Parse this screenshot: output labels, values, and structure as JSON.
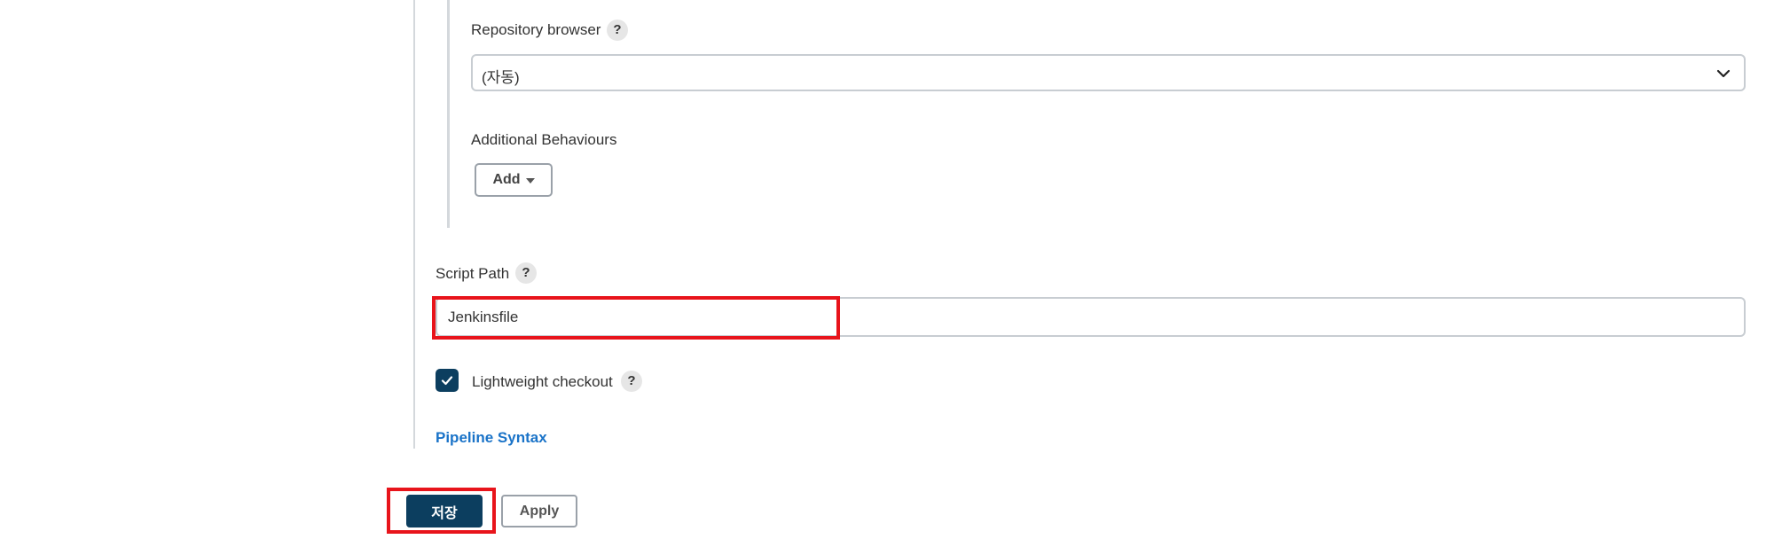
{
  "repository_browser": {
    "label": "Repository browser",
    "help_icon": "?",
    "selected_value": "(자동)"
  },
  "additional_behaviours": {
    "label": "Additional Behaviours",
    "add_label": "Add"
  },
  "script_path": {
    "label": "Script Path",
    "help_icon": "?",
    "value": "Jenkinsfile"
  },
  "lightweight_checkout": {
    "label": "Lightweight checkout",
    "help_icon": "?",
    "checked": true
  },
  "pipeline_syntax": {
    "label": "Pipeline Syntax"
  },
  "actions": {
    "save_label": "저장",
    "apply_label": "Apply"
  },
  "colors": {
    "primary": "#0c3e5f",
    "link": "#1a73c8",
    "highlight": "#e8141b"
  },
  "icons": {
    "help": "question-mark-icon",
    "dropdown": "chevron-down-icon",
    "add_caret": "caret-down-icon",
    "checkbox": "check-icon"
  }
}
